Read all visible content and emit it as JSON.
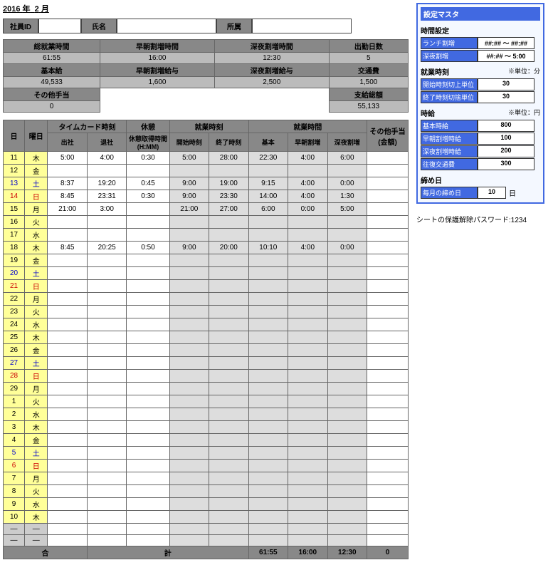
{
  "header": {
    "year": "2016",
    "year_suffix": "年",
    "month": "2",
    "month_suffix": "月"
  },
  "emp": {
    "id_lbl": "社員ID",
    "id": "",
    "name_lbl": "氏名",
    "name": "",
    "dept_lbl": "所属",
    "dept": ""
  },
  "summary": {
    "r1": [
      "総就業時間",
      "早朝割増時間",
      "深夜割増時間",
      "出勤日数"
    ],
    "r1v": [
      "61:55",
      "16:00",
      "12:30",
      "5"
    ],
    "r2": [
      "基本給",
      "早朝割増給与",
      "深夜割増給与",
      "交通費"
    ],
    "r2v": [
      "49,533",
      "1,600",
      "2,500",
      "1,500"
    ],
    "r3a": "その他手当",
    "r3a_v": "0",
    "r3b": "支給総額",
    "r3b_v": "55,133"
  },
  "tc_head": {
    "day": "日",
    "dow": "曜日",
    "punch": "タイムカード時刻",
    "break": "休憩",
    "work": "就業時刻",
    "hours": "就業時間",
    "other": "その他手当(金額)",
    "in": "出社",
    "out": "退社",
    "break_t": "休憩取得時間(H:MM)",
    "start": "開始時刻",
    "end": "終了時刻",
    "base": "基本",
    "am": "早朝割増",
    "pm": "深夜割増"
  },
  "rows": [
    {
      "d": "11",
      "w": "木",
      "in": "5:00",
      "out": "4:00",
      "br": "0:30",
      "st": "5:00",
      "en": "28:00",
      "b": "22:30",
      "am": "4:00",
      "pm": "6:00"
    },
    {
      "d": "12",
      "w": "金"
    },
    {
      "d": "13",
      "w": "土",
      "in": "8:37",
      "out": "19:20",
      "br": "0:45",
      "st": "9:00",
      "en": "19:00",
      "b": "9:15",
      "am": "4:00",
      "pm": "0:00",
      "wknd": "b"
    },
    {
      "d": "14",
      "w": "日",
      "in": "8:45",
      "out": "23:31",
      "br": "0:30",
      "st": "9:00",
      "en": "23:30",
      "b": "14:00",
      "am": "4:00",
      "pm": "1:30",
      "wknd": "r"
    },
    {
      "d": "15",
      "w": "月",
      "in": "21:00",
      "out": "3:00",
      "st": "21:00",
      "en": "27:00",
      "b": "6:00",
      "am": "0:00",
      "pm": "5:00"
    },
    {
      "d": "16",
      "w": "火"
    },
    {
      "d": "17",
      "w": "水"
    },
    {
      "d": "18",
      "w": "木",
      "in": "8:45",
      "out": "20:25",
      "br": "0:50",
      "st": "9:00",
      "en": "20:00",
      "b": "10:10",
      "am": "4:00",
      "pm": "0:00"
    },
    {
      "d": "19",
      "w": "金"
    },
    {
      "d": "20",
      "w": "土",
      "wknd": "b"
    },
    {
      "d": "21",
      "w": "日",
      "wknd": "r"
    },
    {
      "d": "22",
      "w": "月"
    },
    {
      "d": "23",
      "w": "火"
    },
    {
      "d": "24",
      "w": "水"
    },
    {
      "d": "25",
      "w": "木"
    },
    {
      "d": "26",
      "w": "金"
    },
    {
      "d": "27",
      "w": "土",
      "wknd": "b"
    },
    {
      "d": "28",
      "w": "日",
      "wknd": "r"
    },
    {
      "d": "29",
      "w": "月"
    },
    {
      "d": "1",
      "w": "火"
    },
    {
      "d": "2",
      "w": "水"
    },
    {
      "d": "3",
      "w": "木"
    },
    {
      "d": "4",
      "w": "金"
    },
    {
      "d": "5",
      "w": "土",
      "wknd": "b"
    },
    {
      "d": "6",
      "w": "日",
      "wknd": "r"
    },
    {
      "d": "7",
      "w": "月"
    },
    {
      "d": "8",
      "w": "火"
    },
    {
      "d": "9",
      "w": "水"
    },
    {
      "d": "10",
      "w": "木"
    },
    {
      "d": "—",
      "w": "—",
      "dash": true
    },
    {
      "d": "—",
      "w": "—",
      "dash": true
    }
  ],
  "total": {
    "lbl1": "合",
    "lbl2": "計",
    "b": "61:55",
    "am": "16:00",
    "pm": "12:30",
    "oth": "0"
  },
  "master": {
    "title": "設定マスタ",
    "time_lbl": "時間設定",
    "lunch": "ランチ割増",
    "lunch_v": "##:## 〜 ##:##",
    "late": "深夜割増",
    "late_v": "##:## 〜 5:00",
    "worktime_lbl": "就業時刻",
    "note_min": "※単位：分",
    "start_unit": "開始時刻切上単位",
    "start_unit_v": "30",
    "end_unit": "終了時刻切捨単位",
    "end_unit_v": "30",
    "wage_lbl": "時給",
    "note_yen": "※単位：円",
    "base": "基本時給",
    "base_v": "800",
    "am": "早朝割増時給",
    "am_v": "100",
    "pm": "深夜割増時給",
    "pm_v": "200",
    "trans": "往復交通費",
    "trans_v": "300",
    "close_lbl": "締め日",
    "close": "毎月の締め日",
    "close_v": "10",
    "close_suf": "日"
  },
  "pw_label": "シートの保護解除パスワード:",
  "pw_val": "1234"
}
